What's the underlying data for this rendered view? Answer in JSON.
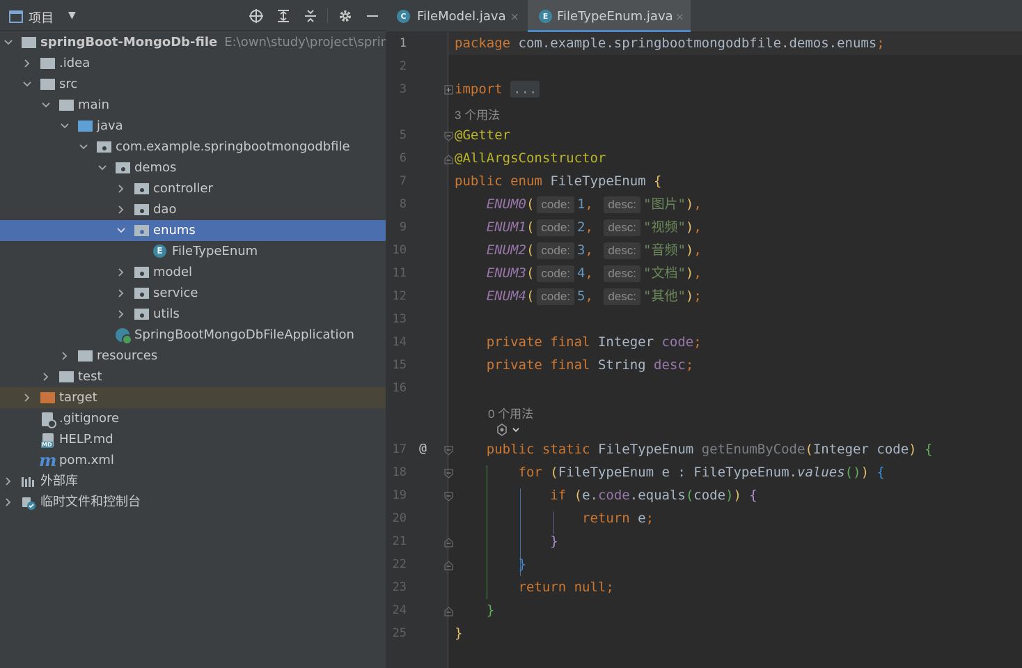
{
  "colors": {
    "selection": "#4b6eaf",
    "excluded_row": "#4a4539",
    "keyword": "#cc7832",
    "annotation": "#bbb529",
    "string": "#6a8759",
    "number": "#6897bb",
    "field": "#9876aa",
    "active_tab_underline": "#4a88c7"
  },
  "panel": {
    "title": "项目",
    "icons": [
      "locate-icon",
      "expand-all-icon",
      "collapse-all-icon",
      "gear-icon",
      "hide-icon"
    ]
  },
  "tree": {
    "root_name": "springBoot-MongoDb-file",
    "root_path": "E:\\own\\study\\project\\springB",
    "idea": ".idea",
    "src": "src",
    "main": "main",
    "java": "java",
    "package": "com.example.springbootmongodbfile",
    "demos": "demos",
    "controller": "controller",
    "dao": "dao",
    "enums": "enums",
    "file_type_enum": "FileTypeEnum",
    "model": "model",
    "service": "service",
    "utils": "utils",
    "application": "SpringBootMongoDbFileApplication",
    "resources": "resources",
    "test": "test",
    "target": "target",
    "gitignore": ".gitignore",
    "help_md": "HELP.md",
    "pom": "pom.xml",
    "external_libs": "外部库",
    "scratches": "临时文件和控制台"
  },
  "tabs": [
    {
      "icon_letter": "C",
      "label": "FileModel.java",
      "close": "×"
    },
    {
      "icon_letter": "E",
      "label": "FileTypeEnum.java",
      "close": "×"
    }
  ],
  "code": {
    "line_numbers": [
      "1",
      "2",
      "3",
      "5",
      "6",
      "7",
      "8",
      "9",
      "10",
      "11",
      "12",
      "13",
      "14",
      "15",
      "16",
      "17",
      "18",
      "19",
      "20",
      "21",
      "22",
      "23",
      "24",
      "25"
    ],
    "package_kw": "package",
    "package_name": "com.example.springbootmongodbfile.demos.enums",
    "semicolon": ";",
    "import_kw": "import",
    "import_fold": "...",
    "usages_3": "3 个用法",
    "usages_0": "0 个用法",
    "ann_getter": "@Getter",
    "ann_allargs": "@AllArgsConstructor",
    "public_kw": "public",
    "enum_kw": "enum",
    "class_name": "FileTypeEnum",
    "open_brace": "{",
    "close_brace": "}",
    "hint_code": "code:",
    "hint_desc": "desc:",
    "enums": [
      {
        "name": "ENUM0",
        "code": "1",
        "desc": "\"图片\""
      },
      {
        "name": "ENUM1",
        "code": "2",
        "desc": "\"视频\""
      },
      {
        "name": "ENUM2",
        "code": "3",
        "desc": "\"音频\""
      },
      {
        "name": "ENUM3",
        "code": "4",
        "desc": "\"文档\""
      },
      {
        "name": "ENUM4",
        "code": "5",
        "desc": "\"其他\""
      }
    ],
    "private_kw": "private",
    "final_kw": "final",
    "static_kw": "static",
    "integer_type": "Integer",
    "string_type": "String",
    "field_code": "code",
    "field_desc": "desc",
    "method_name": "getEnumByCode",
    "param": "code",
    "for_kw": "for",
    "var_e": "e",
    "colon": ":",
    "values_call": "values",
    "if_kw": "if",
    "equals_call": "equals",
    "return_kw": "return",
    "null_kw": "null",
    "at_marker": "@"
  }
}
